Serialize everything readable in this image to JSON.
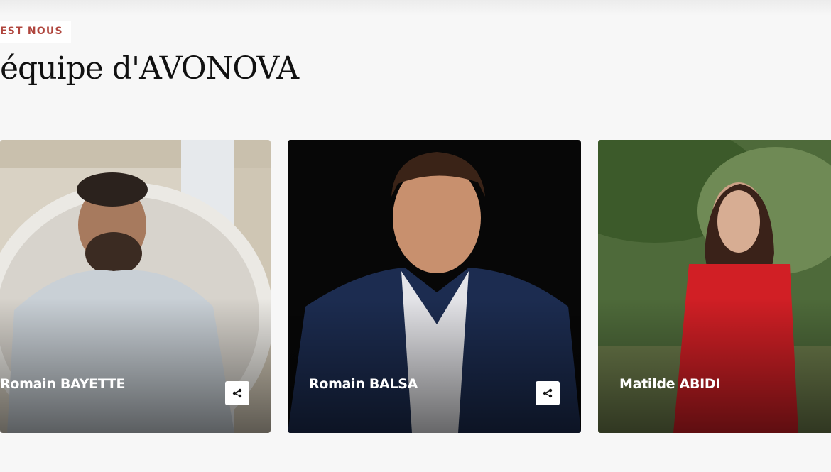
{
  "section": {
    "eyebrow": "EST NOUS",
    "title": "équipe d'AVONOVA"
  },
  "team": [
    {
      "name": "Romain BAYETTE",
      "share_icon": "share-icon"
    },
    {
      "name": "Romain BALSA",
      "share_icon": "share-icon"
    },
    {
      "name": "Matilde ABIDI"
    }
  ],
  "colors": {
    "accent": "#b0463e",
    "page_background": "#f7f7f7",
    "title": "#111111"
  }
}
